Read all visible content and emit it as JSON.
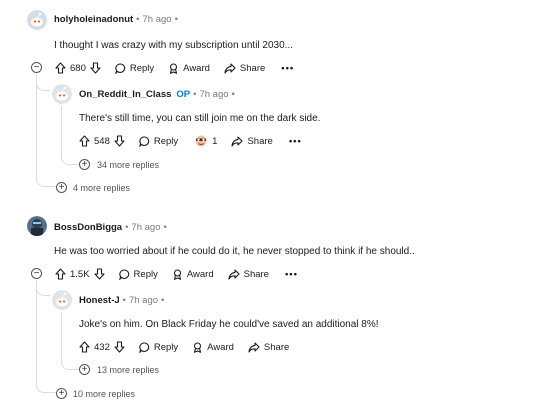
{
  "comments": [
    {
      "author": "holyholeinadonut",
      "time": "7h ago",
      "text": "I thought I was crazy with my subscription until 2030...",
      "score": "680",
      "reply_label": "Reply",
      "award_label": "Award",
      "share_label": "Share",
      "more_label": "•••",
      "collapse_label": "−",
      "replies": [
        {
          "author": "On_Reddit_In_Class",
          "badge": "OP",
          "time": "7h ago",
          "text": "There's still time, you can still join me on the dark side.",
          "score": "548",
          "reply_label": "Reply",
          "award_count": "1",
          "share_label": "Share",
          "more_label": "•••",
          "more_replies": "34 more replies"
        }
      ],
      "more_replies": "4 more replies"
    },
    {
      "author": "BossDonBigga",
      "time": "7h ago",
      "text": "He was too worried about if he could do it, he never stopped to think if he should..",
      "score": "1.5K",
      "reply_label": "Reply",
      "award_label": "Award",
      "share_label": "Share",
      "more_label": "•••",
      "collapse_label": "−",
      "replies": [
        {
          "author": "Honest-J",
          "time": "7h ago",
          "text": "Joke's on him. On Black Friday he could've saved an additional 8%!",
          "score": "432",
          "reply_label": "Reply",
          "award_label": "Award",
          "share_label": "Share",
          "more_replies": "13 more replies"
        }
      ],
      "more_replies": "10 more replies"
    }
  ],
  "dot": "•",
  "plus": "+",
  "colors": {
    "op": "#0079d3",
    "thread_line": "#dcdcdc",
    "muted": "#7c7c7c"
  }
}
